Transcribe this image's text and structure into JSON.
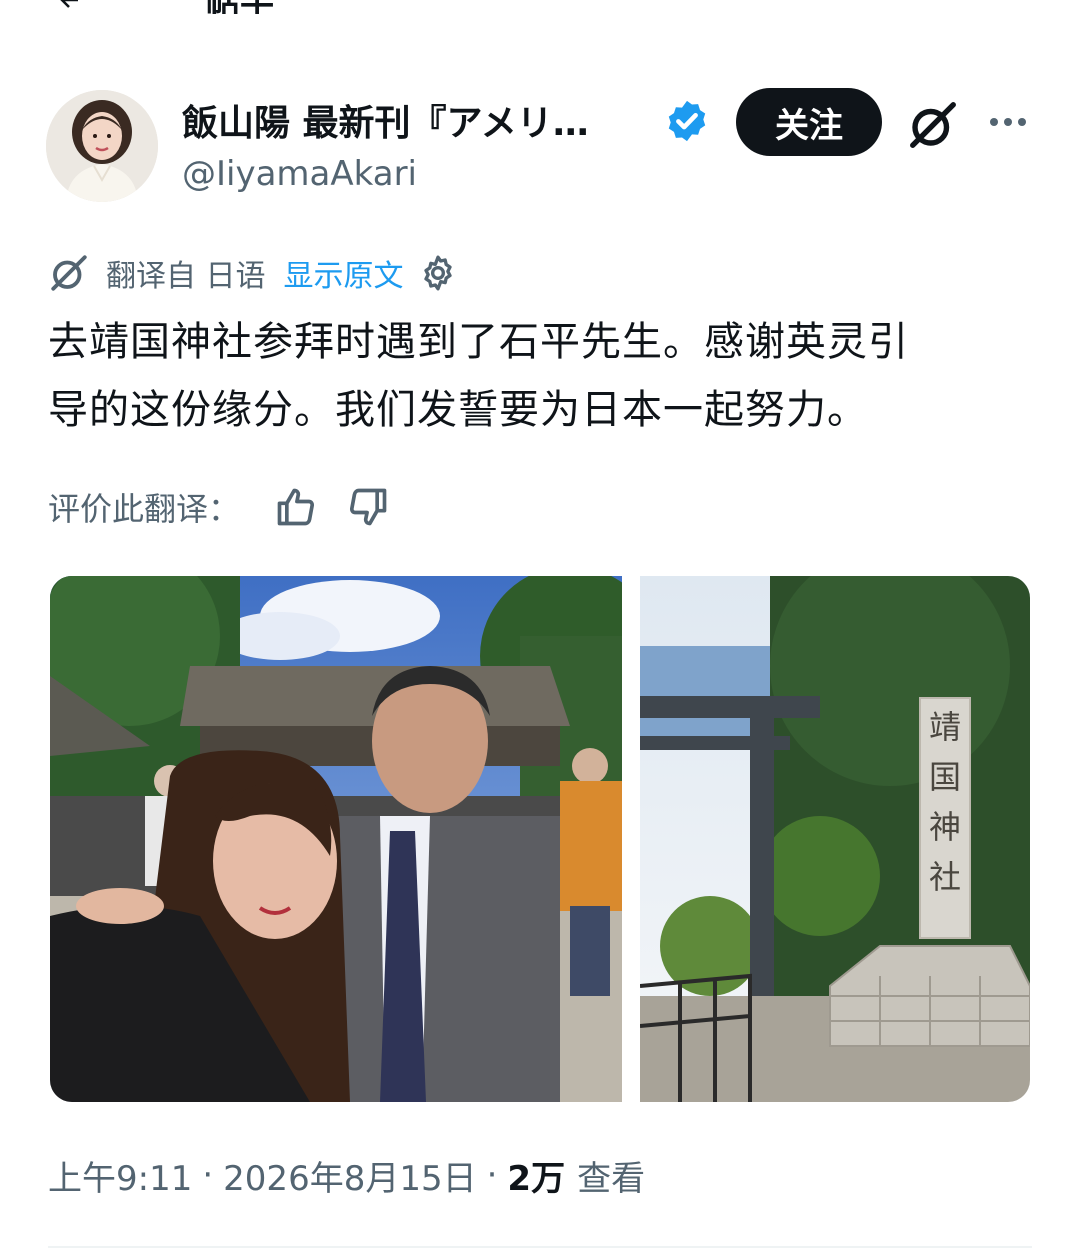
{
  "header": {
    "title_partial": "帖子"
  },
  "author": {
    "display_name": "飯山陽 最新刊『アメリ…",
    "handle": "@IiyamaAkari",
    "verified": true,
    "follow_label": "关注"
  },
  "translation": {
    "from_text": "翻译自 日语",
    "show_original": "显示原文",
    "rate_label": "评价此翻译："
  },
  "tweet": {
    "line1": "去靖国神社参拜时遇到了石平先生。感谢英灵引",
    "line2": "导的这份缘分。我们发誓要为日本一起努力。"
  },
  "media": {
    "count": 2,
    "pillar_text": [
      "靖",
      "国",
      "神",
      "社"
    ]
  },
  "meta": {
    "time": "上午9:11",
    "date": "2026年8月15日",
    "separator": "·",
    "views_count": "2万",
    "views_label": "查看"
  },
  "colors": {
    "text_primary": "#0f1419",
    "text_secondary": "#536471",
    "link_blue": "#1d9bf0",
    "verified_blue": "#1d9bf0",
    "follow_button_bg": "#0f1419"
  },
  "icons": [
    "back-arrow-icon",
    "verified-badge-icon",
    "grok-icon",
    "more-icon",
    "translate-icon",
    "settings-gear-icon",
    "thumbs-up-icon",
    "thumbs-down-icon"
  ]
}
